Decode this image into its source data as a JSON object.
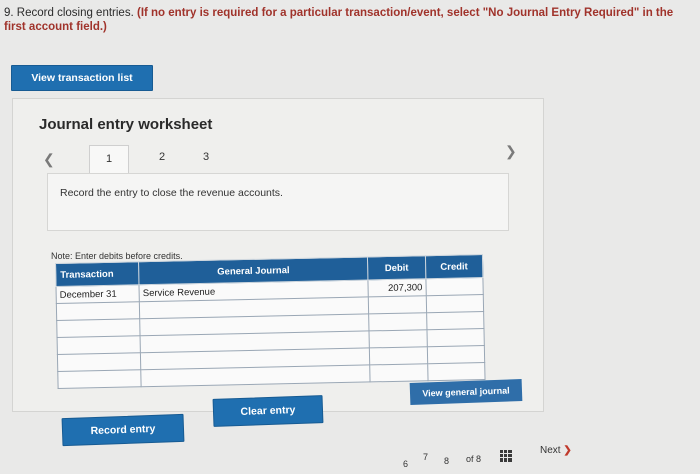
{
  "question": {
    "number": "9.",
    "text": "Record closing entries.",
    "instruction": "(If no entry is required for a particular transaction/event, select \"No Journal Entry Required\" in the first account field.)"
  },
  "buttons": {
    "view_transaction_list": "View transaction list",
    "record_entry": "Record entry",
    "clear_entry": "Clear entry",
    "view_general_journal": "View general journal"
  },
  "worksheet": {
    "title": "Journal entry worksheet",
    "tabs": [
      "1",
      "2",
      "3"
    ],
    "active_tab": "1",
    "prev_icon": "chevron-left-icon",
    "next_icon": "chevron-right-icon",
    "entry_instruction": "Record the entry to close the revenue accounts.",
    "note": "Note: Enter debits before credits."
  },
  "journal": {
    "headers": {
      "transaction": "Transaction",
      "general_journal": "General Journal",
      "debit": "Debit",
      "credit": "Credit"
    },
    "rows": [
      {
        "transaction": "December 31",
        "account": "Service Revenue",
        "debit": "207,300",
        "credit": ""
      },
      {
        "transaction": "",
        "account": "",
        "debit": "",
        "credit": ""
      },
      {
        "transaction": "",
        "account": "",
        "debit": "",
        "credit": ""
      },
      {
        "transaction": "",
        "account": "",
        "debit": "",
        "credit": ""
      },
      {
        "transaction": "",
        "account": "",
        "debit": "",
        "credit": ""
      },
      {
        "transaction": "",
        "account": "",
        "debit": "",
        "credit": ""
      }
    ]
  },
  "pagination": {
    "pages": [
      "6",
      "7",
      "8"
    ],
    "of_label": "of 8",
    "next_label": "Next"
  }
}
